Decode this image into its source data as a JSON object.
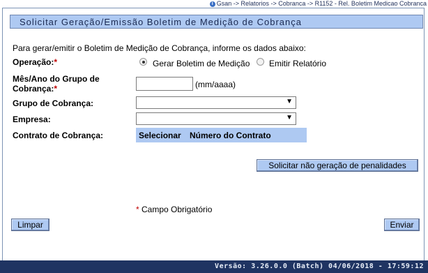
{
  "breadcrumb": "Gsan -> Relatorios -> Cobranca -> R1152 - Rel. Boletim Medicao Cobranca",
  "title": "Solicitar Geração/Emissão Boletim de Medição de Cobrança",
  "intro": "Para gerar/emitir o Boletim de Medição de Cobrança, informe os dados abaixo:",
  "operacao": {
    "label": "Operação:",
    "required": "*",
    "option1": "Gerar Boletim de Medição",
    "option2": "Emitir Relatório"
  },
  "mes_ano": {
    "label_line1": "Mês/Ano do Grupo de",
    "label_line2": "Cobrança:",
    "required": "*",
    "value": "",
    "hint": "(mm/aaaa)"
  },
  "grupo": {
    "label": "Grupo de Cobrança:",
    "value": ""
  },
  "empresa": {
    "label": "Empresa:",
    "value": ""
  },
  "contrato": {
    "label": "Contrato de Cobrança:",
    "columns": [
      "Selecionar",
      "Número do Contrato"
    ]
  },
  "buttons": {
    "penalidades": "Solicitar não geração de penalidades",
    "limpar": "Limpar",
    "enviar": "Enviar"
  },
  "required_note": {
    "mark": "*",
    "text": "Campo Obrigatório"
  },
  "footer": "Versão: 3.26.0.0 (Batch) 04/06/2018 - 17:59:12"
}
